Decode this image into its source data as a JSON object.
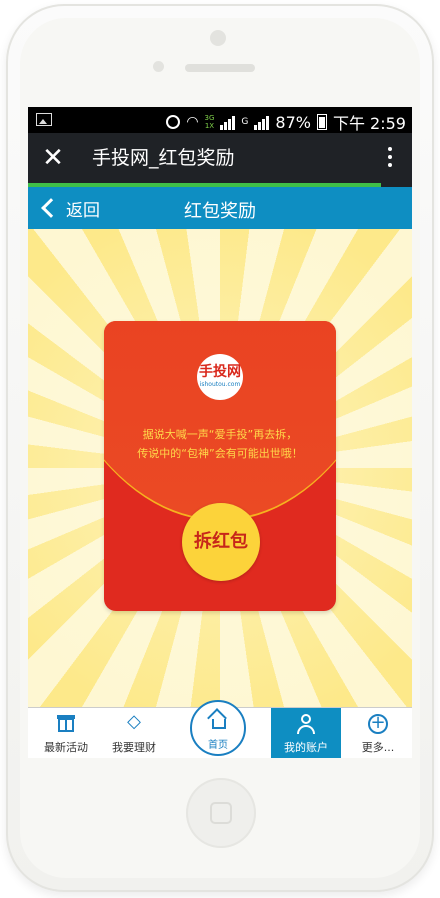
{
  "status_bar": {
    "network_top": "3G",
    "network_bottom": "1X",
    "signal_type": "G",
    "battery": "87%",
    "time": "下午 2:59"
  },
  "title_bar": {
    "title": "手投网_红包奖励",
    "close_icon": "close-icon",
    "menu_icon": "more-vert-icon"
  },
  "page_load_progress": 0.92,
  "nav_bar": {
    "back_label": "返回",
    "title": "红包奖励"
  },
  "red_envelope": {
    "logo_text": "手投网",
    "logo_domain": "ishoutou.com",
    "message_line1": "据说大喊一声“爱手投”再去拆，",
    "message_line2": "传说中的“包神”会有可能出世哦！",
    "open_button": "拆红包"
  },
  "tab_bar": {
    "items": [
      {
        "label": "最新活动",
        "icon": "gift-icon"
      },
      {
        "label": "我要理财",
        "icon": "diamond-icon"
      },
      {
        "label": "首页",
        "icon": "home-icon"
      },
      {
        "label": "我的账户",
        "icon": "user-icon",
        "active": true
      },
      {
        "label": "更多...",
        "icon": "plus-circle-icon"
      }
    ]
  },
  "colors": {
    "nav_blue": "#0e8ec2",
    "envelope_red": "#e02a1f",
    "button_yellow": "#fcd33a",
    "progress_green": "#3fbf47"
  }
}
